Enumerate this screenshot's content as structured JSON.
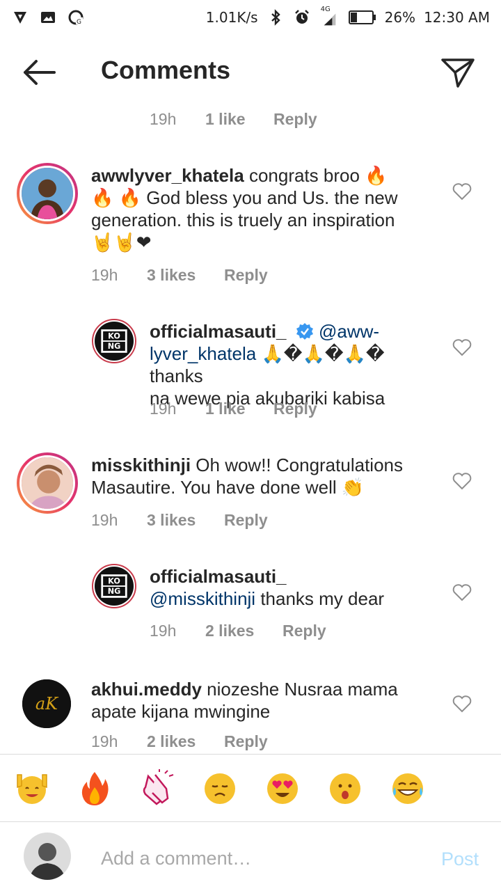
{
  "status_bar": {
    "network_speed": "1.01K/s",
    "network_type": "4G",
    "battery": "26%",
    "time": "12:30 AM"
  },
  "header": {
    "title": "Comments"
  },
  "top_meta": {
    "time": "19h",
    "likes": "1 like",
    "reply": "Reply"
  },
  "comments": [
    {
      "username": "awwlyver_khatela",
      "text_parts": [
        "congrats broo 🔥",
        "🔥 🔥 God bless you and Us. the new",
        "generation. this is truely an inspiration",
        "🤘🤘❤"
      ],
      "time": "19h",
      "likes": "3 likes",
      "reply": "Reply"
    },
    {
      "username": "officialmasauti_",
      "mention": "@aww-",
      "mention2": "lyver_khatela",
      "text_parts": [
        "🙏�🙏�🙏� thanks",
        "na wewe pia akubariki kabisa"
      ],
      "time": "19h",
      "likes": "1 like",
      "reply": "Reply"
    },
    {
      "username": "misskithinji",
      "text_parts": [
        "Oh wow!! Congratulations",
        "Masautire. You have done well 👏"
      ],
      "time": "19h",
      "likes": "3 likes",
      "reply": "Reply"
    },
    {
      "username": "officialmasauti_",
      "mention": "@misskithinji",
      "text_parts": [
        "thanks my dear"
      ],
      "time": "19h",
      "likes": "2 likes",
      "reply": "Reply"
    },
    {
      "username": "akhui.meddy",
      "text_parts": [
        "niozeshe Nusraa mama",
        "apate kijana mwingine"
      ],
      "time": "19h",
      "likes": "2 likes",
      "reply": "Reply"
    }
  ],
  "logos": {
    "kong_top": "KO",
    "kong_bottom": "NG",
    "ak": "aK"
  },
  "composer": {
    "placeholder": "Add a comment…",
    "post_label": "Post"
  },
  "colors": {
    "accent_link": "#003569",
    "post_disabled": "#b2dffc",
    "meta_gray": "#8e8e8e",
    "heart_red": "#e2445c",
    "verified_blue": "#3897f0"
  }
}
